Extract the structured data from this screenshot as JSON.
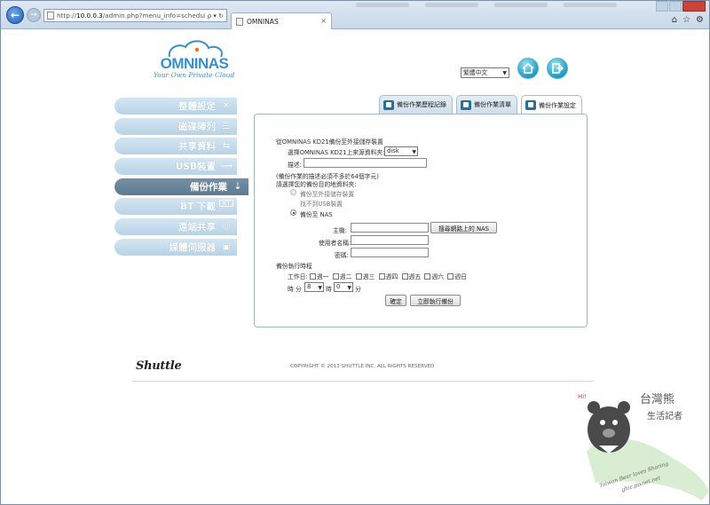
{
  "browser": {
    "url_prefix": "http://",
    "url_host": "10.0.0.3",
    "url_path": "/admin.php?menu_info=scheduling",
    "addr_tools": "ρ ▾ ↻",
    "tab_title": "OMNINAS",
    "tab_close": "×"
  },
  "header": {
    "logo_text": "OMNINAS",
    "slogan": "Your Own Private Cloud",
    "language": "繁體中文"
  },
  "sidebar": {
    "items": [
      {
        "label": "整體設定",
        "icon": "tools-icon",
        "glyph": "✕"
      },
      {
        "label": "磁碟陣列",
        "icon": "disk-array-icon",
        "glyph": "☰"
      },
      {
        "label": "共享資料",
        "icon": "share-folder-icon",
        "glyph": "⇆"
      },
      {
        "label": "USB裝置",
        "icon": "usb-icon",
        "glyph": "⟶"
      },
      {
        "label": "備份作業",
        "icon": "backup-icon",
        "glyph": "⇣"
      },
      {
        "label": "BT 下載",
        "icon": "bt-icon",
        "glyph": "BT"
      },
      {
        "label": "遠端共享",
        "icon": "web-share-icon",
        "glyph": "◎"
      },
      {
        "label": "媒體伺服器",
        "icon": "media-server-icon",
        "glyph": "▣"
      }
    ],
    "active_index": 4
  },
  "tabs": [
    {
      "label": "備份作業歷程記錄"
    },
    {
      "label": "備份作業清單"
    },
    {
      "label": "備份作業設定"
    }
  ],
  "form": {
    "source_title": "從OMNINAS KD21備份至外接儲存裝置",
    "source_select_label": "選擇OMNINAS KD21上來源資料夾:",
    "source_select_value": "disk",
    "description_label": "描述:",
    "description_value": "",
    "description_hint": "(備份作業的描述必須不多於64個字元)",
    "target_title": "請選擇您的備份目的地資料夾:",
    "opt_external_label": "備份至外接儲存裝置",
    "opt_external_note": "找不到USB裝置",
    "opt_nas_label": "備份至 NAS",
    "host_label": "主機:",
    "host_value": "",
    "scan_button": "搜尋網路上的 NAS",
    "username_label": "使用者名稱:",
    "username_value": "",
    "password_label": "密碼:",
    "password_value": "",
    "schedule_title": "備份執行時程",
    "workday_label": "工作日:",
    "weekdays": [
      "週一",
      "週二",
      "週三",
      "週四",
      "週五",
      "週六",
      "週日"
    ],
    "hour_label": "時",
    "minute_label": "分",
    "hour_value": "8",
    "minute_value": "0",
    "ok_button": "確定",
    "run_now_button": "立即執行備份"
  },
  "footer": {
    "brand": "Shuttle",
    "copyright": "COPYRIGHT © 2013 SHUTTLE INC. ALL RIGHTS RESERVED"
  },
  "watermark": {
    "hi": "Hi!",
    "title": "台灣熊",
    "subtitle": "生活記者",
    "line1": "Taiwan Bear loves Sharing",
    "line2": "ghic.pixnet.net"
  },
  "colors": {
    "sidebar_active": "#6a859c",
    "sidebar_idle": "#c6dcec",
    "brand_blue": "#3a8fc9",
    "panel_border": "#9cb7cc"
  }
}
